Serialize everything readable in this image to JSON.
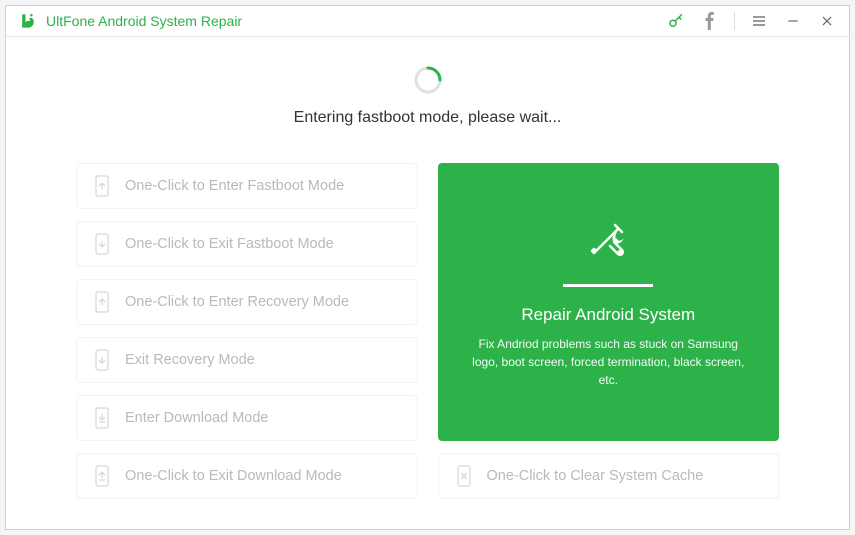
{
  "app": {
    "title": "UltFone Android System Repair"
  },
  "status": {
    "message": "Entering fastboot mode, please wait..."
  },
  "options": {
    "enter_fastboot": "One-Click to Enter Fastboot Mode",
    "exit_fastboot": "One-Click to Exit Fastboot Mode",
    "enter_recovery": "One-Click to Enter Recovery Mode",
    "exit_recovery": "Exit Recovery Mode",
    "enter_download": "Enter Download Mode",
    "exit_download": "One-Click to Exit Download Mode",
    "clear_cache": "One-Click to Clear System Cache"
  },
  "feature": {
    "title": "Repair Android System",
    "description": "Fix Andriod problems such as stuck on Samsung logo, boot screen, forced termination, black screen, etc."
  }
}
